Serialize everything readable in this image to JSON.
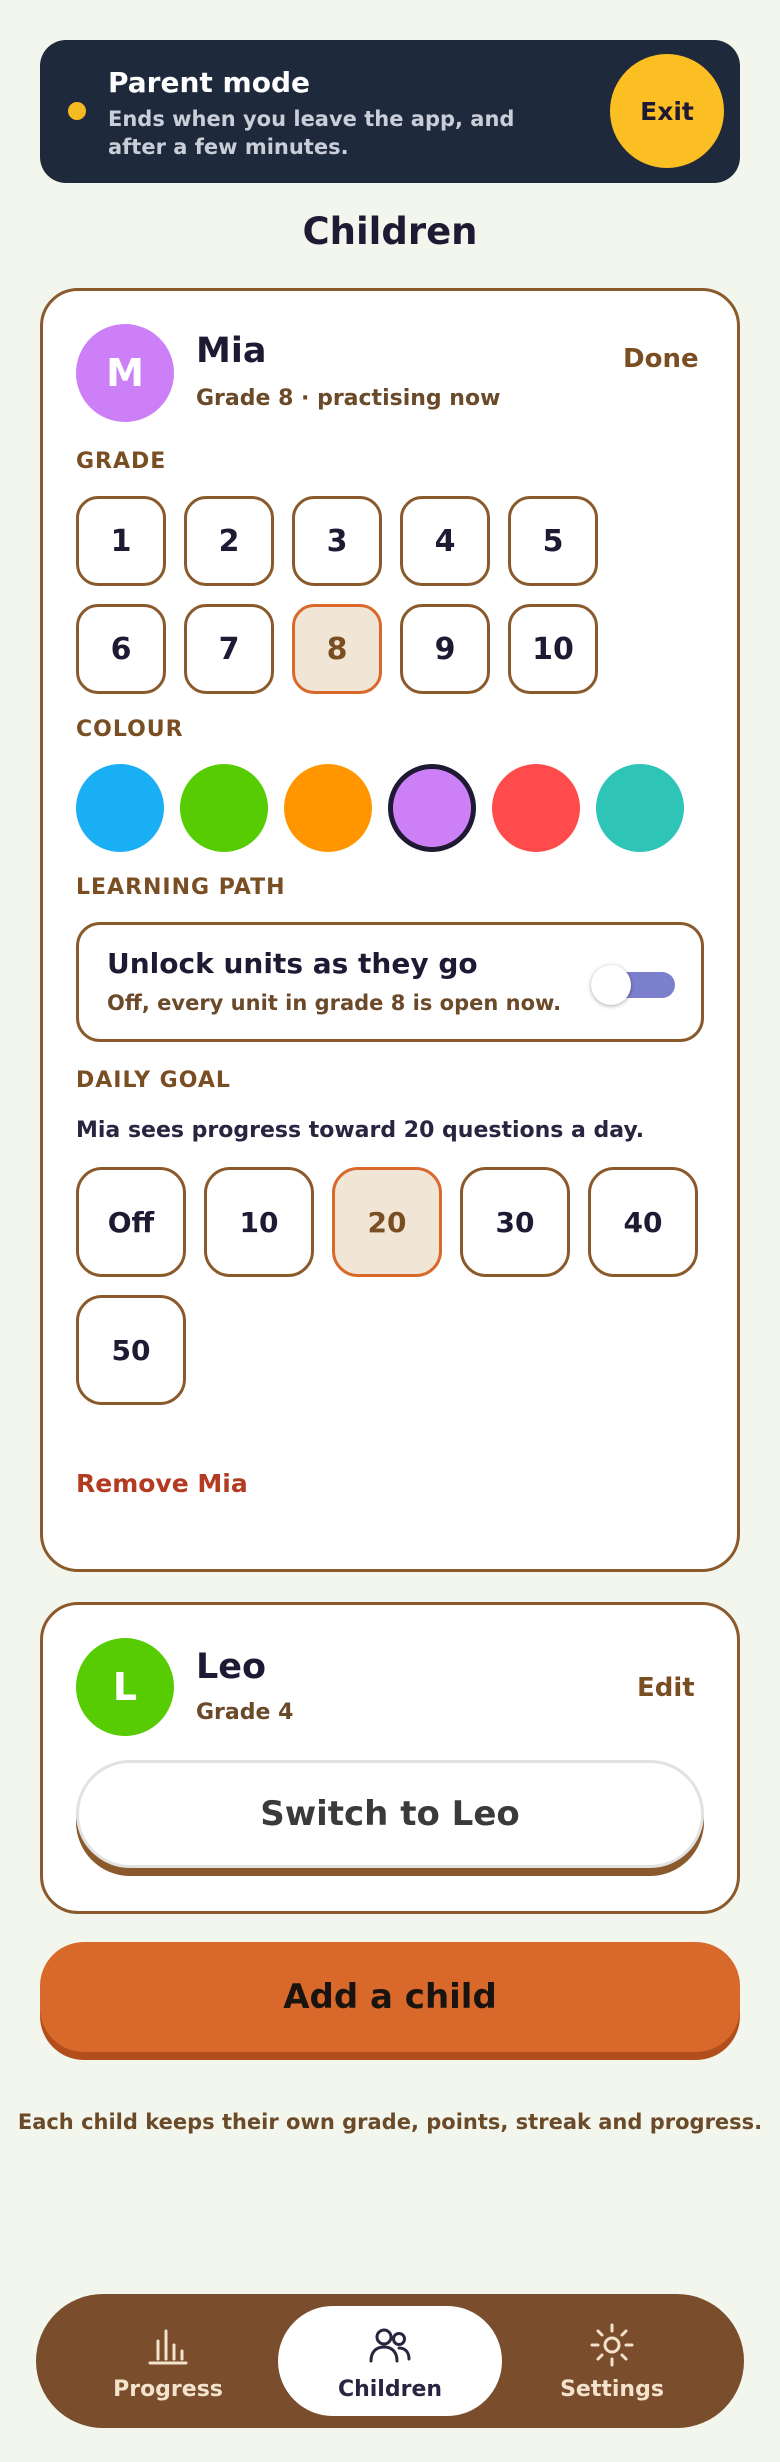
{
  "banner": {
    "title": "Parent mode",
    "subtitle": "Ends when you leave the app, and after a few minutes.",
    "exit_label": "Exit"
  },
  "page_title": "Children",
  "children": [
    {
      "initial": "M",
      "name": "Mia",
      "meta": "Grade 8 · practising now",
      "action_label": "Done",
      "avatar_color": "#cc7ff7",
      "grade_label": "GRADE",
      "grades": [
        "1",
        "2",
        "3",
        "4",
        "5",
        "6",
        "7",
        "8",
        "9",
        "10"
      ],
      "selected_grade": "8",
      "colour_label": "COLOUR",
      "colours": [
        "#1aaff4",
        "#58cc02",
        "#ff9600",
        "#cc7ff7",
        "#ff4b4b",
        "#2ec4b6"
      ],
      "selected_colour": "#cc7ff7",
      "path_label": "LEARNING PATH",
      "path_title": "Unlock units as they go",
      "path_desc": "Off, every unit in grade 8 is open now.",
      "path_enabled": false,
      "goal_label": "DAILY GOAL",
      "goal_desc": "Mia sees progress toward 20 questions a day.",
      "goals": [
        "Off",
        "10",
        "20",
        "30",
        "40",
        "50"
      ],
      "selected_goal": "20",
      "remove_label": "Remove Mia"
    },
    {
      "initial": "L",
      "name": "Leo",
      "meta": "Grade 4",
      "action_label": "Edit",
      "avatar_color": "#58cc02",
      "switch_label": "Switch to Leo"
    }
  ],
  "add_child_label": "Add a child",
  "footnote": "Each child keeps their own grade, points, streak and progress.",
  "nav": {
    "items": [
      {
        "label": "Progress",
        "icon": "bar-chart-icon"
      },
      {
        "label": "Children",
        "icon": "people-icon",
        "active": true
      },
      {
        "label": "Settings",
        "icon": "sun-gear-icon"
      }
    ]
  },
  "colors": {
    "accent": "#d9682b",
    "brown": "#8a5a2c",
    "banner_bg": "#1e2a3b",
    "exit_yellow": "#fbbf24",
    "remove_red": "#b23b22"
  }
}
